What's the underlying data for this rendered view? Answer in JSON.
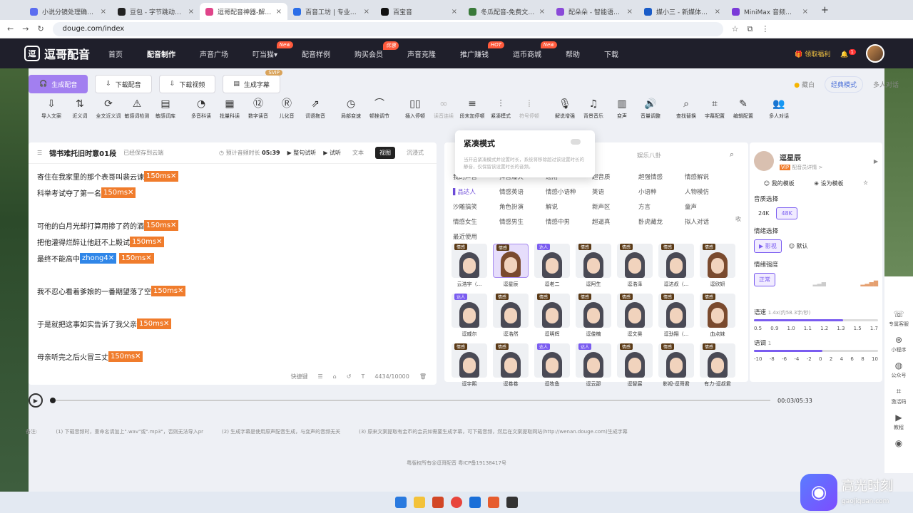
{
  "browser": {
    "tabs": [
      {
        "title": "小说分镜处理确认 - Do",
        "color": "#5b6df0"
      },
      {
        "title": "豆包 - 字节跳动旗下 AI",
        "color": "#222222"
      },
      {
        "title": "逗哥配音神器-解说剧",
        "color": "#e0458a",
        "active": true
      },
      {
        "title": "百音工坊 | 专业智能配",
        "color": "#2b6ee8"
      },
      {
        "title": "百宝音",
        "color": "#111111"
      },
      {
        "title": "冬瓜配音-免费文字转语",
        "color": "#3a7a3a"
      },
      {
        "title": "配朵朵 - 智能语音合成",
        "color": "#8a4ad8"
      },
      {
        "title": "媒小三 - 新媒体工具网",
        "color": "#1a5cc8"
      },
      {
        "title": "MiniMax 音频与音乐",
        "color": "#7a3ad8"
      }
    ],
    "url": "douge.com/index"
  },
  "nav": {
    "logo": "逗哥配音",
    "items": [
      {
        "label": "首页"
      },
      {
        "label": "配音制作",
        "active": true
      },
      {
        "label": "声音广场"
      },
      {
        "label": "叮当猫▾",
        "badge": "New"
      },
      {
        "label": "配音样例"
      },
      {
        "label": "购买会员",
        "badge": "优惠"
      },
      {
        "label": "声音克隆"
      },
      {
        "label": "推广赚钱",
        "badge": "HOT"
      },
      {
        "label": "逗币商城",
        "badge": "New"
      },
      {
        "label": "帮助"
      },
      {
        "label": "下载"
      }
    ],
    "welfare": "领取福利",
    "notif_count": "1"
  },
  "toolbar": {
    "generate": "生成配音",
    "download_audio": "下载配音",
    "download_video": "下载视频",
    "gen_subtitle": "生成字幕",
    "svip": "SVIP",
    "mode_whisper": "藏白",
    "mode_classic": "经典模式",
    "mode_multi": "多人对话"
  },
  "tools": [
    {
      "label": "导入文案",
      "icon": "⇩"
    },
    {
      "label": "近义词",
      "icon": "⇅"
    },
    {
      "label": "全文近义词",
      "icon": "⟳"
    },
    {
      "label": "敏感词检测",
      "icon": "⚠"
    },
    {
      "label": "敏感词库",
      "icon": "▤"
    },
    {
      "label": "多音科读",
      "icon": "◔"
    },
    {
      "label": "批量科读",
      "icon": "▦"
    },
    {
      "label": "数字读音",
      "icon": "⑫"
    },
    {
      "label": "儿化音",
      "icon": "Ⓡ"
    },
    {
      "label": "词语拖音",
      "icon": "⇗"
    },
    {
      "label": "局部变速",
      "icon": "◷"
    },
    {
      "label": "顿挫调节",
      "icon": "⌒"
    },
    {
      "label": "插入停顿",
      "icon": "▯▯"
    },
    {
      "label": "读音连续",
      "icon": "∞",
      "dim": true
    },
    {
      "label": "段末加停顿",
      "icon": "≡"
    },
    {
      "label": "紧凑模式",
      "icon": "⫶"
    },
    {
      "label": "符号停顿",
      "icon": "⁞",
      "dim": true
    },
    {
      "label": "解说增强",
      "icon": "🎙"
    },
    {
      "label": "背景音乐",
      "icon": "♫"
    },
    {
      "label": "变声",
      "icon": "▥"
    },
    {
      "label": "音量调整",
      "icon": "🔊"
    },
    {
      "label": "查找替换",
      "icon": "⌕"
    },
    {
      "label": "字幕配置",
      "icon": "⌗"
    },
    {
      "label": "编辑配置",
      "icon": "✎"
    },
    {
      "label": "多人对话",
      "icon": "👥"
    }
  ],
  "popup": {
    "title": "紧凑模式",
    "desc": "当开启紧凑模式并设置时长，系统将移除超过该设置时长的静音，仅保留该设置时长的音频。"
  },
  "editor": {
    "doc_title": "锦书难托旧时意01段",
    "saved": "已经保存到云端",
    "est_label": "预计音频时长",
    "est_value": "05:39",
    "preview_seg": "整句试听",
    "preview": "试听",
    "view_text": "文本",
    "view_graph": "视图",
    "view_immersive": "沉浸式",
    "lines": [
      {
        "text": "寄住在我家里的那个表哥叫裴云谏",
        "tag": "150ms✕"
      },
      {
        "text": "科举考试夺了第一名",
        "tag": "150ms✕"
      },
      {
        "text": "",
        "tag": ""
      },
      {
        "text": "可他的白月光却打算用掺了药的酒",
        "tag": "150ms✕"
      },
      {
        "text": "把他灌得烂醉让他赶不上殿试",
        "tag": "150ms✕"
      },
      {
        "text": "最终不能高中",
        "tag": "150ms✕",
        "pinyin": "zhong4✕"
      },
      {
        "text": "",
        "tag": ""
      },
      {
        "text": "我不忍心看着爹娘的一番期望落了空",
        "tag": "150ms✕"
      },
      {
        "text": "",
        "tag": ""
      },
      {
        "text": "于是就把这事如实告诉了我父亲",
        "tag": "150ms✕"
      },
      {
        "text": "",
        "tag": ""
      },
      {
        "text": "母亲听完之后火冒三丈",
        "tag": "150ms✕"
      }
    ],
    "shortcut": "快捷键",
    "count": "4434/10000"
  },
  "voices": {
    "search_hint": "娱乐八卦",
    "categories": [
      {
        "label": "我的声音"
      },
      {
        "label": "抖音爆火"
      },
      {
        "label": "通用"
      },
      {
        "label": "超音质"
      },
      {
        "label": "超强情感"
      },
      {
        "label": "情感解说"
      },
      {
        "label": "▌品达人",
        "hl": true
      },
      {
        "label": "情感英语"
      },
      {
        "label": "情感小语种"
      },
      {
        "label": "英语"
      },
      {
        "label": "小语种"
      },
      {
        "label": "人物模仿"
      },
      {
        "label": "沙雕搞笑"
      },
      {
        "label": "角色扮演"
      },
      {
        "label": "解说"
      },
      {
        "label": "新声区"
      },
      {
        "label": "方言"
      },
      {
        "label": "童声"
      },
      {
        "label": "情感女生"
      },
      {
        "label": "情感男生"
      },
      {
        "label": "情感中男"
      },
      {
        "label": "超逼真"
      },
      {
        "label": "卧虎藏龙"
      },
      {
        "label": "拟人对话"
      },
      {
        "label": "最近使用"
      }
    ],
    "collapse": "收",
    "list": [
      {
        "name": "云浩宇（...",
        "tag": "情感"
      },
      {
        "name": "逗星辰",
        "tag": "情感",
        "sel": true,
        "f": true
      },
      {
        "name": "逗老二",
        "tag": "达人"
      },
      {
        "name": "逗阿生",
        "tag": "情感"
      },
      {
        "name": "逗浩泽",
        "tag": "情感"
      },
      {
        "name": "逗达叔（...",
        "tag": "情感"
      },
      {
        "name": "逗欣妍",
        "tag": "情感",
        "f": true
      },
      {
        "name": "逗威尔",
        "tag": "达人"
      },
      {
        "name": "逗浩然",
        "tag": "情感"
      },
      {
        "name": "逗明辉",
        "tag": "情感"
      },
      {
        "name": "逗俊楠",
        "tag": "情感"
      },
      {
        "name": "逗文昊",
        "tag": "情感"
      },
      {
        "name": "逗劲翔（...",
        "tag": "情感"
      },
      {
        "name": "血点妹",
        "tag": "情感",
        "f": true
      },
      {
        "name": "逗宇熙",
        "tag": "情感"
      },
      {
        "name": "逗卷卷",
        "tag": "情感"
      },
      {
        "name": "逗牧鱼",
        "tag": "达人"
      },
      {
        "name": "逗云邵",
        "tag": "达人"
      },
      {
        "name": "逗智宸",
        "tag": "情感"
      },
      {
        "name": "影视-逗哥君",
        "tag": "情感"
      },
      {
        "name": "有力-逗叔君",
        "tag": "情感"
      }
    ]
  },
  "detail": {
    "name": "逗星辰",
    "vip": "VIP",
    "detail_link": "配音员详情 >",
    "my_template": "我的模板",
    "set_template": "设为模板",
    "quality_label": "音质选择",
    "q1": "24K",
    "q2": "48K",
    "emotion_label": "情绪选择",
    "emo1": "影视",
    "emo2": "默认",
    "intensity_label": "情绪强度",
    "intensity": "正常",
    "speed_label": "语速",
    "speed_note": "1.4x(约58.3字/秒)",
    "speed_scale": [
      "0.5",
      "0.9",
      "1.0",
      "1.1",
      "1.2",
      "1.3",
      "1.5",
      "1.7"
    ],
    "speed_level": 0.72,
    "pitch_label": "语调",
    "pitch_value": "1",
    "pitch_scale": [
      "-10",
      "-8",
      "-6",
      "-4",
      "-2",
      "0",
      "2",
      "4",
      "6",
      "8",
      "10"
    ],
    "pitch_level": 0.55
  },
  "player": {
    "time": "00:03/05:33"
  },
  "notes": [
    "备注:",
    "(1) 下载音频时，重命名请加上\".wav\"或\".mp3\"，否则无法导入pr",
    "(2) 生成字幕是使用原声配音生成，与变声的音频无关",
    "(3) 原来文案提取有金币的会员如需要生成字幕，可下载音频，然后在文案提取网站(http://wenan.douge.com)生成字幕"
  ],
  "copyright": "粤版权所有@逗哥配音  粤ICP备19138417号",
  "sidebar": [
    {
      "label": "专属客服",
      "icon": "☏"
    },
    {
      "label": "小程序",
      "icon": "⊛"
    },
    {
      "label": "公众号",
      "icon": "◍"
    },
    {
      "label": "激活码",
      "icon": "⌗"
    },
    {
      "label": "教程",
      "icon": "▶"
    },
    {
      "label": "",
      "icon": "◉"
    }
  ],
  "watermark": {
    "text": "高光时刻",
    "sub": "gaojiquan.com"
  }
}
